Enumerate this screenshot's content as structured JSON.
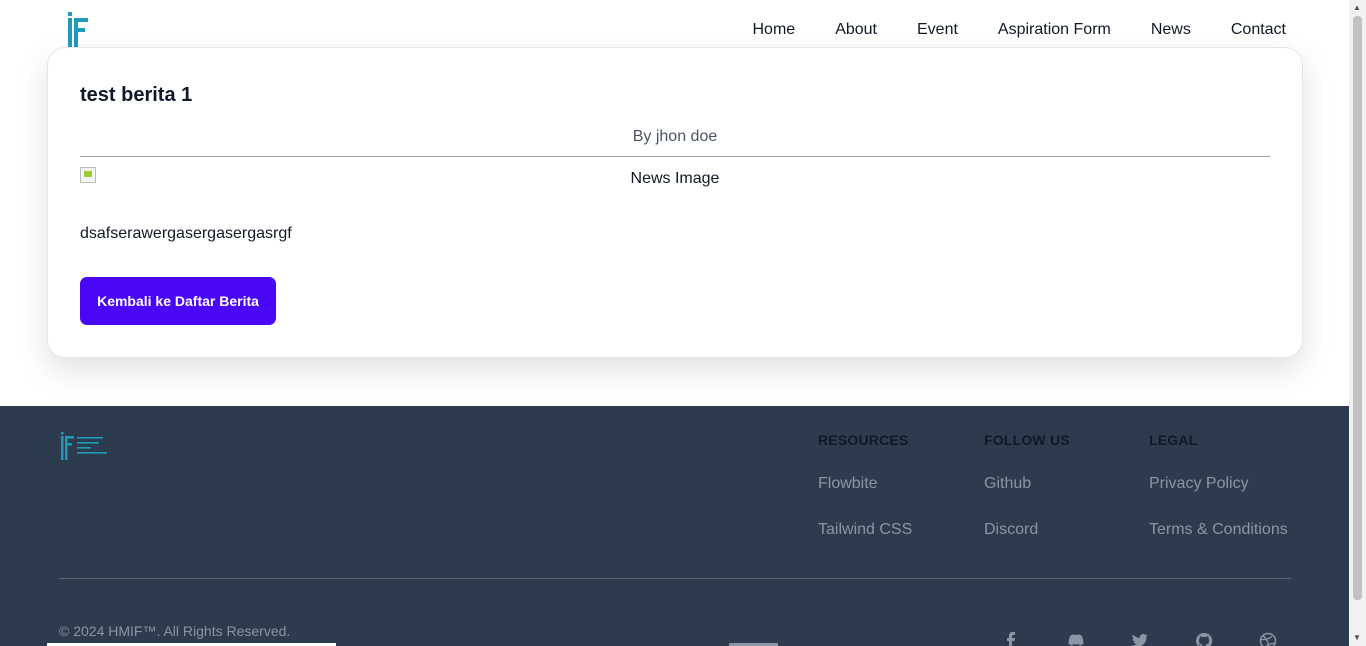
{
  "nav": {
    "items": [
      "Home",
      "About",
      "Event",
      "Aspiration Form",
      "News",
      "Contact"
    ]
  },
  "article": {
    "title": "test berita 1",
    "author": "By jhon doe",
    "image_alt": "News Image",
    "body": "dsafserawergasergasergasrgf",
    "back_label": "Kembali ke Daftar Berita"
  },
  "footer": {
    "columns": [
      {
        "heading": "RESOURCES",
        "links": [
          "Flowbite",
          "Tailwind CSS"
        ]
      },
      {
        "heading": "FOLLOW US",
        "links": [
          "Github",
          "Discord"
        ]
      },
      {
        "heading": "LEGAL",
        "links": [
          "Privacy Policy",
          "Terms & Conditions"
        ]
      }
    ],
    "copyright": "© 2024 HMIF™. All Rights Reserved.",
    "socials": [
      "facebook-icon",
      "discord-icon",
      "twitter-icon",
      "github-icon",
      "dribbble-icon"
    ]
  },
  "colors": {
    "brand_teal": "#1f9bb8",
    "button": "#4a06f7",
    "footer_bg": "#2d3b4e"
  }
}
